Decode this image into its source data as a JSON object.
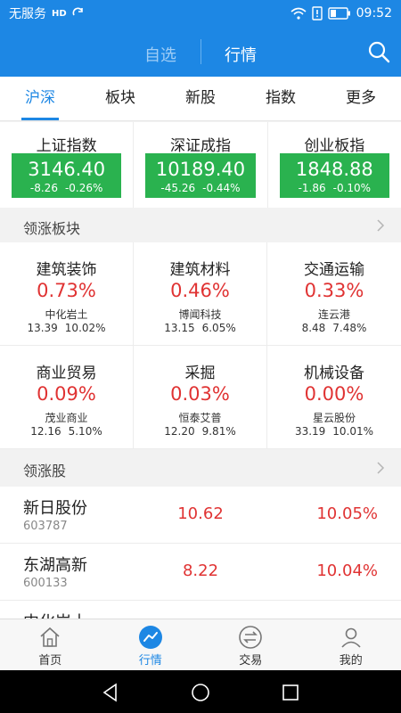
{
  "status_bar": {
    "carrier": "无服务",
    "hd": "HD",
    "time": "09:52"
  },
  "app_bar": {
    "tabs": [
      "自选",
      "行情"
    ],
    "active_tab": "行情",
    "search_icon": "search-icon"
  },
  "category_tabs": [
    {
      "label": "沪深",
      "active": true
    },
    {
      "label": "板块",
      "active": false
    },
    {
      "label": "新股",
      "active": false
    },
    {
      "label": "指数",
      "active": false
    },
    {
      "label": "更多",
      "active": false
    }
  ],
  "indices": [
    {
      "name": "上证指数",
      "value": "3146.40",
      "change": "-8.26",
      "pct": "-0.26%"
    },
    {
      "name": "深证成指",
      "value": "10189.40",
      "change": "-45.26",
      "pct": "-0.44%"
    },
    {
      "name": "创业板指",
      "value": "1848.88",
      "change": "-1.86",
      "pct": "-0.10%"
    }
  ],
  "colors": {
    "brand_blue": "#1d87e4",
    "down_green": "#2ab24f",
    "up_red": "#e03333"
  },
  "leading_sectors": {
    "title": "领涨板块",
    "items": [
      {
        "name": "建筑装饰",
        "pct": "0.73%",
        "stock": "中化岩土",
        "price": "13.39",
        "stock_pct": "10.02%"
      },
      {
        "name": "建筑材料",
        "pct": "0.46%",
        "stock": "博闻科技",
        "price": "13.15",
        "stock_pct": "6.05%"
      },
      {
        "name": "交通运输",
        "pct": "0.33%",
        "stock": "连云港",
        "price": "8.48",
        "stock_pct": "7.48%"
      },
      {
        "name": "商业贸易",
        "pct": "0.09%",
        "stock": "茂业商业",
        "price": "12.16",
        "stock_pct": "5.10%"
      },
      {
        "name": "采掘",
        "pct": "0.03%",
        "stock": "恒泰艾普",
        "price": "12.20",
        "stock_pct": "9.81%"
      },
      {
        "name": "机械设备",
        "pct": "0.00%",
        "stock": "星云股份",
        "price": "33.19",
        "stock_pct": "10.01%"
      }
    ]
  },
  "leading_stocks": {
    "title": "领涨股",
    "items": [
      {
        "name": "新日股份",
        "code": "603787",
        "price": "10.62",
        "pct": "10.05%"
      },
      {
        "name": "东湖高新",
        "code": "600133",
        "price": "8.22",
        "pct": "10.04%"
      },
      {
        "name": "中化岩土",
        "code": "",
        "price": "",
        "pct": ""
      }
    ]
  },
  "bottom_nav": [
    {
      "label": "首页",
      "icon": "home-icon",
      "active": false
    },
    {
      "label": "行情",
      "icon": "market-trend-icon",
      "active": true
    },
    {
      "label": "交易",
      "icon": "trade-exchange-icon",
      "active": false
    },
    {
      "label": "我的",
      "icon": "profile-icon",
      "active": false
    }
  ],
  "system_nav": {
    "back": "back-icon",
    "home": "home-circle-icon",
    "recents": "recents-icon"
  }
}
